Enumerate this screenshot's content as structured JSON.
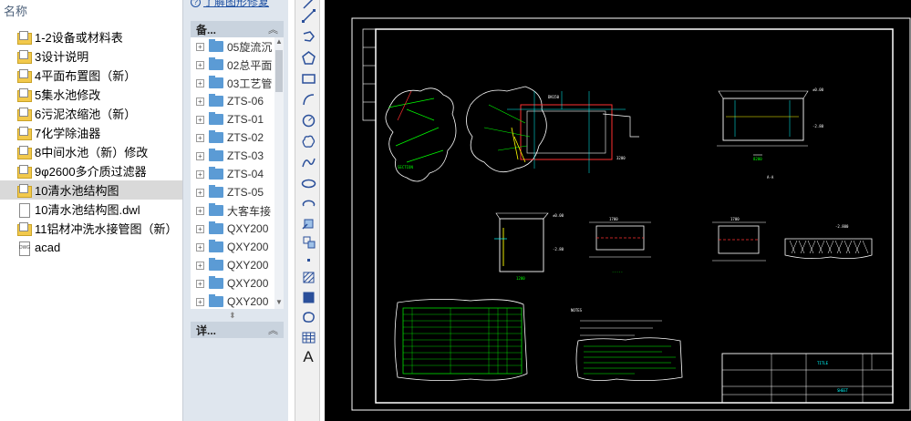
{
  "file_pane": {
    "column_header": "名称",
    "files": [
      {
        "name": "1-2设备或材料表",
        "icon": "dwg-folder-icon"
      },
      {
        "name": "3设计说明",
        "icon": "dwg-folder-icon"
      },
      {
        "name": "4平面布置图（新）",
        "icon": "dwg-folder-icon"
      },
      {
        "name": "5集水池修改",
        "icon": "dwg-folder-icon"
      },
      {
        "name": "6污泥浓缩池（新）",
        "icon": "dwg-folder-icon"
      },
      {
        "name": "7化学除油器",
        "icon": "dwg-folder-icon"
      },
      {
        "name": "8中间水池（新）修改",
        "icon": "dwg-folder-icon"
      },
      {
        "name": "9φ2600多介质过滤器",
        "icon": "dwg-folder-icon"
      },
      {
        "name": "10清水池结构图",
        "icon": "dwg-folder-icon",
        "selected": true
      },
      {
        "name": "10清水池结构图.dwl",
        "icon": "document-icon"
      },
      {
        "name": "11铝材冲洗水接管图（新）",
        "icon": "dwg-folder-icon"
      },
      {
        "name": "acad",
        "icon": "acad-file-icon"
      }
    ]
  },
  "middle_pane": {
    "help_link": "了解图形修复",
    "backup_header": "备...",
    "details_header": "详...",
    "tree_items": [
      "05旋流沉",
      "02总平面",
      "03工艺管",
      "ZTS-06",
      "ZTS-01",
      "ZTS-02",
      "ZTS-03",
      "ZTS-04",
      "ZTS-05",
      "大客车接",
      "QXY200",
      "QXY200",
      "QXY200",
      "QXY200",
      "QXY200"
    ]
  },
  "toolbar": {
    "tools": [
      {
        "name": "line-icon"
      },
      {
        "name": "polyline-icon"
      },
      {
        "name": "polygon-icon"
      },
      {
        "name": "rectangle-icon"
      },
      {
        "name": "arc-icon"
      },
      {
        "name": "circle-icon"
      },
      {
        "name": "revision-cloud-icon"
      },
      {
        "name": "spline-icon"
      },
      {
        "name": "ellipse-icon"
      },
      {
        "name": "ellipse-arc-icon"
      },
      {
        "name": "insert-block-icon"
      },
      {
        "name": "make-block-icon"
      },
      {
        "name": "point-icon"
      },
      {
        "name": "hatch-icon"
      },
      {
        "name": "gradient-icon"
      },
      {
        "name": "region-icon"
      },
      {
        "name": "table-icon"
      },
      {
        "name": "multiline-text-icon"
      }
    ],
    "text_tool_label": "A"
  },
  "canvas": {
    "background": "#000000",
    "line_color": "#ffffff",
    "green": "#00ff00",
    "cyan": "#00ffff",
    "red": "#ff3030",
    "yellow": "#ffff00"
  }
}
